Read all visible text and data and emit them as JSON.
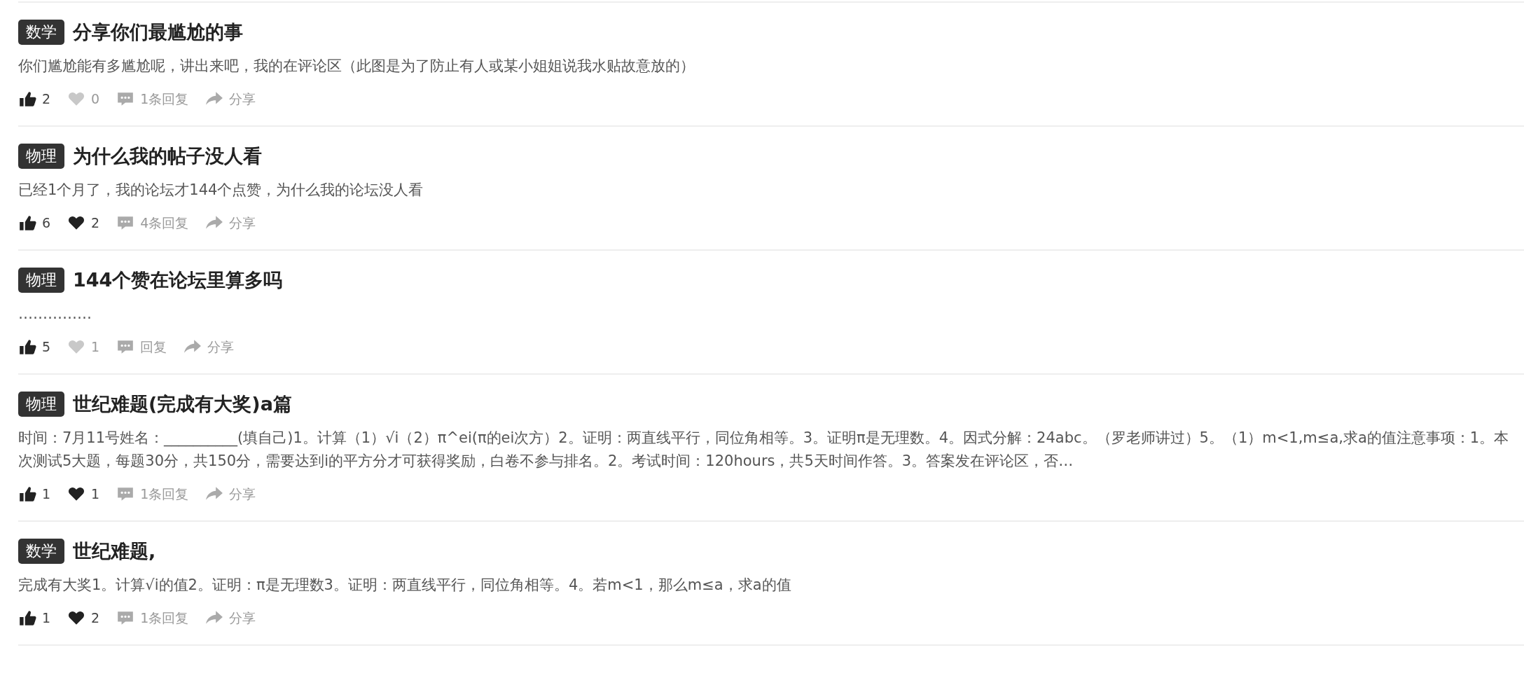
{
  "posts": [
    {
      "tag": "数学",
      "title": "分享你们最尴尬的事",
      "excerpt": "你们尴尬能有多尴尬呢，讲出来吧，我的在评论区（此图是为了防止有人或某小姐姐说我水贴故意放的）",
      "likes": {
        "count": "2",
        "selected": true
      },
      "favorites": {
        "count": "0",
        "selected": false
      },
      "replies": "1条回复",
      "share": "分享"
    },
    {
      "tag": "物理",
      "title": "为什么我的帖子没人看",
      "excerpt": "已经1个月了，我的论坛才144个点赞，为什么我的论坛没人看",
      "likes": {
        "count": "6",
        "selected": true
      },
      "favorites": {
        "count": "2",
        "selected": true
      },
      "replies": "4条回复",
      "share": "分享"
    },
    {
      "tag": "物理",
      "title": "144个赞在论坛里算多吗",
      "excerpt": "……………",
      "likes": {
        "count": "5",
        "selected": true
      },
      "favorites": {
        "count": "1",
        "selected": false
      },
      "replies": "回复",
      "share": "分享"
    },
    {
      "tag": "物理",
      "title": "世纪难题(完成有大奖)a篇",
      "excerpt": "时间：7月11号姓名：__________(填自己)1。计算（1）√i（2）π^ei(π的ei次方）2。证明：两直线平行，同位角相等。3。证明π是无理数。4。因式分解：24abc。（罗老师讲过）5。（1）m<1,m≤a,求a的值注意事项：1。本次测试5大题，每题30分，共150分，需要达到i的平方分才可获得奖励，白卷不参与排名。2。考试时间：120hours，共5天时间作答。3。答案发在评论区，否…",
      "likes": {
        "count": "1",
        "selected": true
      },
      "favorites": {
        "count": "1",
        "selected": true
      },
      "replies": "1条回复",
      "share": "分享"
    },
    {
      "tag": "数学",
      "title": "世纪难题,",
      "excerpt": "完成有大奖1。计算√i的值2。证明：π是无理数3。证明：两直线平行，同位角相等。4。若m<1，那么m≤a，求a的值",
      "likes": {
        "count": "1",
        "selected": true
      },
      "favorites": {
        "count": "2",
        "selected": true
      },
      "replies": "1条回复",
      "share": "分享"
    }
  ]
}
